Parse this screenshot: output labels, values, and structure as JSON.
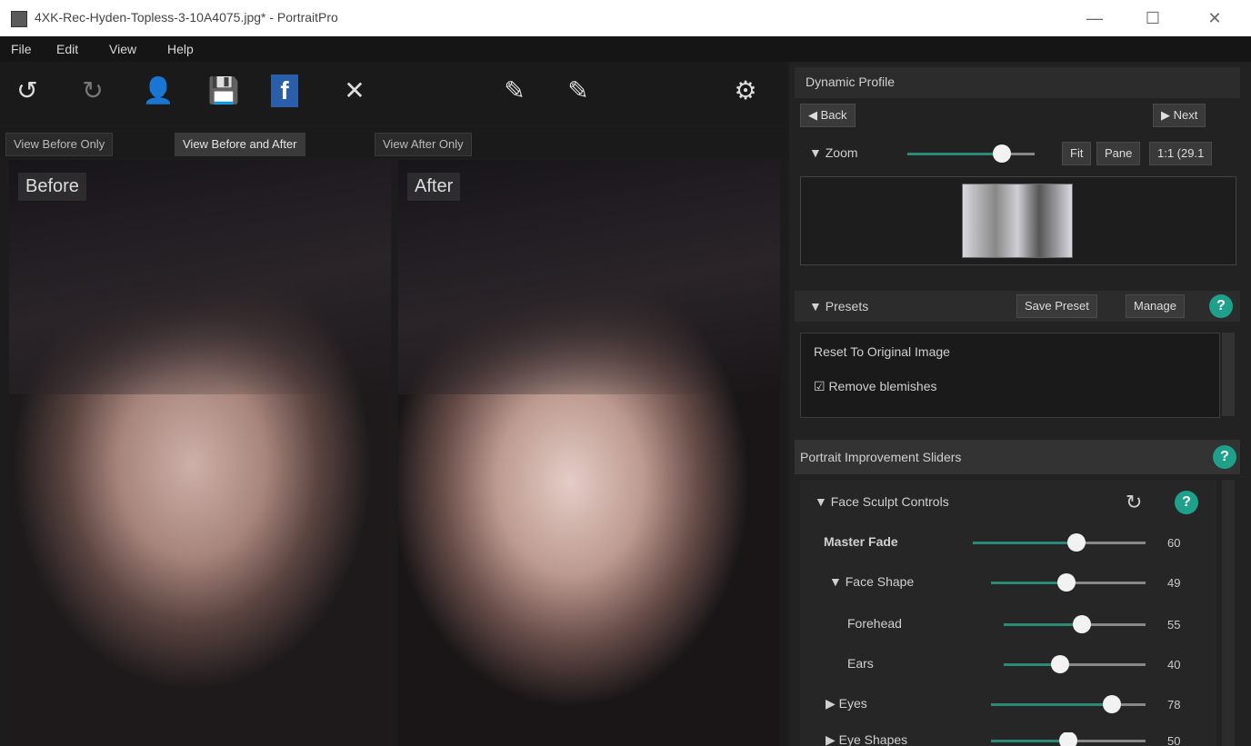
{
  "window": {
    "title": "4XK-Rec-Hyden-Topless-3-10A4075.jpg* - PortraitPro",
    "minimize": "—",
    "maximize": "☐",
    "close": "✕"
  },
  "menu": [
    "File",
    "Edit",
    "View",
    "Help"
  ],
  "toolbar": {
    "undo_icon": "↺",
    "redo_icon": "↻",
    "person_icon": "👤",
    "save_icon": "💾",
    "facebook_icon": "f",
    "close_icon": "✕",
    "brush1_icon": "✎",
    "brush2_icon": "✎",
    "settings_icon": "⚙"
  },
  "view_tabs": [
    "View Before Only",
    "View Before and After",
    "View After Only"
  ],
  "panes": {
    "before_label": "Before",
    "after_label": "After"
  },
  "sidebar": {
    "title": "Dynamic Profile",
    "back": "◀ Back",
    "next": "▶ Next",
    "zoom": {
      "label": "▼ Zoom",
      "value": 0.74,
      "fit": "Fit",
      "pane": "Pane",
      "ratio": "1:1 (29.1"
    },
    "presets": {
      "label": "▼ Presets",
      "save": "Save Preset",
      "manage": "Manage",
      "help": "?",
      "items": [
        "Reset To Original Image",
        "☑ Remove blemishes"
      ]
    },
    "sliders_header": {
      "label": "Portrait Improvement Sliders",
      "help": "?"
    },
    "sculpt": {
      "label": "▼ Face Sculpt Controls",
      "reset_icon": "↻",
      "help": "?",
      "rows": [
        {
          "label": "Master Fade",
          "value": 60,
          "num": "60"
        },
        {
          "label": "▼ Face Shape",
          "value": 49,
          "num": "49"
        },
        {
          "label": "Forehead",
          "value": 55,
          "num": "55"
        },
        {
          "label": "Ears",
          "value": 40,
          "num": "40"
        },
        {
          "label": "▶ Eyes",
          "value": 78,
          "num": "78"
        },
        {
          "label": "▶ Eye Shapes",
          "value": 50,
          "num": "50"
        }
      ]
    }
  }
}
